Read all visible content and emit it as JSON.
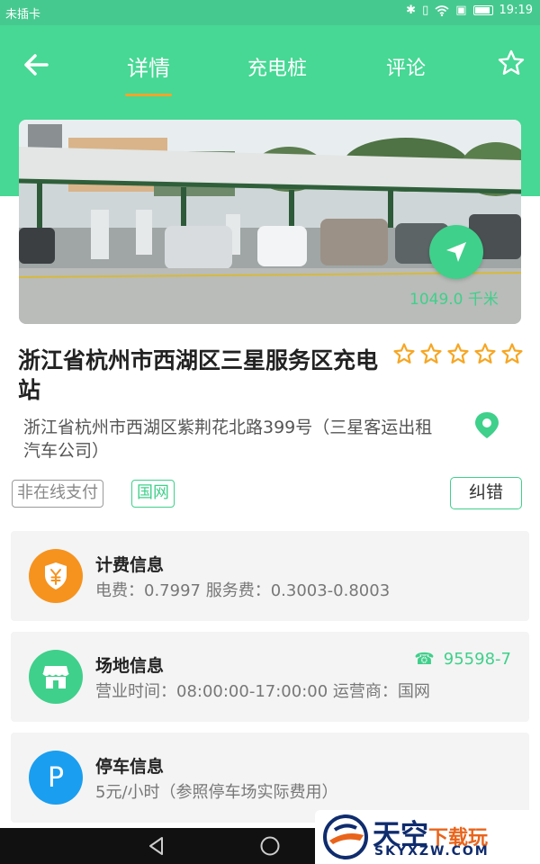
{
  "status_bar": {
    "carrier": "未插卡",
    "time": "19:19"
  },
  "header": {
    "tabs": [
      {
        "label": "详情",
        "active": true
      },
      {
        "label": "充电桩",
        "active": false
      },
      {
        "label": "评论",
        "active": false
      }
    ],
    "indicator_color": "#f4a32c"
  },
  "station": {
    "distance": "1049.0 千米",
    "name": "浙江省杭州市西湖区三星服务区充电站",
    "rating_stars": 5,
    "rating_filled": 0,
    "address": "浙江省杭州市西湖区紫荆花北路399号（三星客运出租汽车公司）"
  },
  "tags": {
    "payment": "非在线支付",
    "operator": "国网"
  },
  "correct_button": "纠错",
  "cards": {
    "billing": {
      "title": "计费信息",
      "detail": "电费：0.7997  服务费：0.3003-0.8003",
      "icon": "shield-yuan-icon",
      "icon_color": "#f6931e"
    },
    "venue": {
      "title": "场地信息",
      "detail": "营业时间：08:00:00-17:00:00  运营商：国网",
      "phone": "95598-7",
      "icon": "store-icon",
      "icon_color": "#3fd08b"
    },
    "parking": {
      "title": "停车信息",
      "detail": "5元/小时（参照停车场实际费用）",
      "icon_letter": "P",
      "icon_color": "#1a9ef0"
    }
  },
  "watermark": {
    "brand": "天空",
    "brand_sub": "下载玩",
    "url": "SKYXZW.COM"
  },
  "colors": {
    "primary": "#46d894",
    "accent": "#3fd08b",
    "text_dark": "#222222",
    "text_gray": "#777777"
  }
}
